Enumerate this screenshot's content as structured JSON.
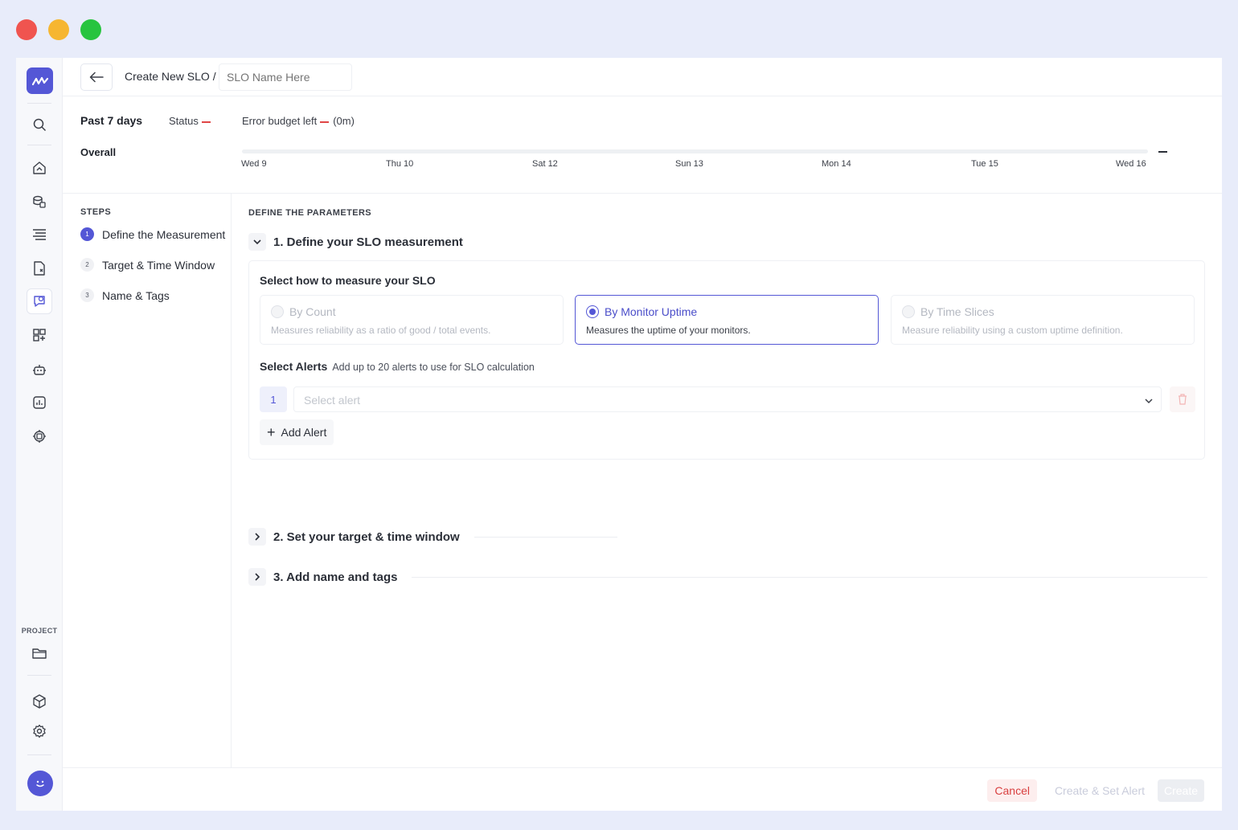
{
  "window_controls": [
    "close",
    "minimize",
    "maximize"
  ],
  "rail": {
    "icons": [
      "logo-icon",
      "search-icon",
      "home-icon",
      "database-icon",
      "list-icon",
      "report-icon",
      "slo-icon",
      "dashboard-add-icon",
      "robot-icon",
      "analytics-icon",
      "chip-icon"
    ],
    "project_label": "PROJECT",
    "bottom_icons": [
      "folder-icon",
      "cube-icon",
      "gear-icon"
    ]
  },
  "header": {
    "breadcrumb": "Create New SLO /",
    "name_placeholder": "SLO Name Here"
  },
  "summary": {
    "range": "Past 7 days",
    "status_label": "Status",
    "budget_label": "Error budget left",
    "budget_value": "(0m)",
    "overall_label": "Overall",
    "ticks": [
      "Wed 9",
      "Thu 10",
      "Sat 12",
      "Sun 13",
      "Mon 14",
      "Tue 15",
      "Wed 16"
    ]
  },
  "steps": {
    "title": "STEPS",
    "items": [
      {
        "num": "1",
        "label": "Define the Measurement"
      },
      {
        "num": "2",
        "label": "Target & Time Window"
      },
      {
        "num": "3",
        "label": "Name & Tags"
      }
    ]
  },
  "main": {
    "title": "DEFINE THE PARAMETERS",
    "sections": [
      {
        "label": "1. Define your SLO measurement"
      },
      {
        "label": "2. Set your target & time window"
      },
      {
        "label": "3. Add name and tags"
      }
    ],
    "measure_title": "Select how to measure your SLO",
    "options": [
      {
        "title": "By Count",
        "desc": "Measures reliability as a ratio of good / total events."
      },
      {
        "title": "By Monitor Uptime",
        "desc": "Measures the uptime of your monitors."
      },
      {
        "title": "By Time Slices",
        "desc": "Measure reliability using a custom uptime definition."
      }
    ],
    "selected_option": "By Monitor Uptime",
    "alerts_title": "Select Alerts",
    "alerts_hint": "Add up to 20 alerts to use for SLO calculation",
    "alert_index": "1",
    "alert_placeholder": "Select alert",
    "add_alert": "Add Alert"
  },
  "footer": {
    "cancel": "Cancel",
    "create_set_alert": "Create & Set Alert",
    "create": "Create"
  },
  "colors": {
    "accent": "#5457d6",
    "danger": "#d94040",
    "background": "#e8ecfa"
  }
}
